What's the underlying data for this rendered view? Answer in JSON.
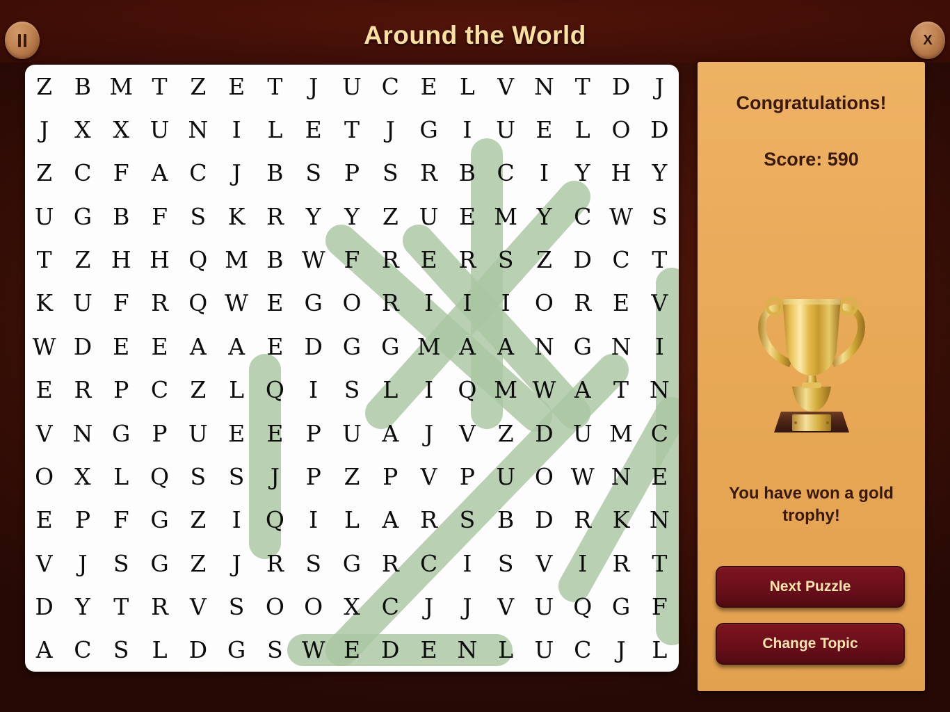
{
  "header": {
    "title": "Around the World",
    "pause_button": {
      "name": "pause-icon",
      "label": "II"
    },
    "close_button": {
      "name": "close-icon",
      "label": "X"
    }
  },
  "panel": {
    "congratulations": "Congratulations!",
    "score_label": "Score: 590",
    "score_value": 590,
    "trophy_icon": "gold-trophy-icon",
    "prize_text": "You have won a gold trophy!",
    "next_puzzle_label": "Next Puzzle",
    "change_topic_label": "Change Topic"
  },
  "colors": {
    "background": "#3a0f07",
    "title": "#fbe0a0",
    "panel_bg": "#e8a957",
    "panel_text": "#3a1a06",
    "button_bg": "#6a0f1a",
    "button_text": "#fbe3ae",
    "grid_bg": "#fdfdfd",
    "letter": "#0c0c0c",
    "highlight": "#a9c6a2"
  },
  "grid": {
    "rows": 14,
    "cols": 17,
    "letters": [
      [
        "Z",
        "B",
        "M",
        "T",
        "Z",
        "E",
        "T",
        "J",
        "U",
        "C",
        "E",
        "L",
        "V",
        "N",
        "T",
        "D",
        "J"
      ],
      [
        "J",
        "X",
        "X",
        "U",
        "N",
        "I",
        "L",
        "E",
        "T",
        "J",
        "G",
        "I",
        "U",
        "E",
        "L",
        "O",
        "D"
      ],
      [
        "Z",
        "C",
        "F",
        "A",
        "C",
        "J",
        "B",
        "S",
        "P",
        "S",
        "R",
        "B",
        "C",
        "I",
        "Y",
        "H",
        "Y"
      ],
      [
        "U",
        "G",
        "B",
        "F",
        "S",
        "K",
        "R",
        "Y",
        "Y",
        "Z",
        "U",
        "E",
        "M",
        "Y",
        "C",
        "W",
        "S"
      ],
      [
        "T",
        "Z",
        "H",
        "H",
        "Q",
        "M",
        "B",
        "W",
        "F",
        "R",
        "E",
        "R",
        "S",
        "Z",
        "D",
        "C",
        "T"
      ],
      [
        "K",
        "U",
        "F",
        "R",
        "Q",
        "W",
        "E",
        "G",
        "O",
        "R",
        "I",
        "I",
        "I",
        "O",
        "R",
        "E",
        "V"
      ],
      [
        "W",
        "D",
        "E",
        "E",
        "A",
        "A",
        "E",
        "D",
        "G",
        "G",
        "M",
        "A",
        "A",
        "N",
        "G",
        "N",
        "I"
      ],
      [
        "E",
        "R",
        "P",
        "C",
        "Z",
        "L",
        "Q",
        "I",
        "S",
        "L",
        "I",
        "Q",
        "M",
        "W",
        "A",
        "T",
        "N"
      ],
      [
        "V",
        "N",
        "G",
        "P",
        "U",
        "E",
        "E",
        "P",
        "U",
        "A",
        "J",
        "V",
        "Z",
        "D",
        "U",
        "M",
        "C"
      ],
      [
        "O",
        "X",
        "L",
        "Q",
        "S",
        "S",
        "J",
        "P",
        "Z",
        "P",
        "V",
        "P",
        "U",
        "O",
        "W",
        "N",
        "E"
      ],
      [
        "E",
        "P",
        "F",
        "G",
        "Z",
        "I",
        "Q",
        "I",
        "L",
        "A",
        "R",
        "S",
        "B",
        "D",
        "R",
        "K",
        "N"
      ],
      [
        "V",
        "J",
        "S",
        "G",
        "Z",
        "J",
        "R",
        "S",
        "G",
        "R",
        "C",
        "I",
        "S",
        "V",
        "I",
        "R",
        "T"
      ],
      [
        "D",
        "Y",
        "T",
        "R",
        "V",
        "S",
        "O",
        "O",
        "X",
        "C",
        "J",
        "J",
        "V",
        "U",
        "Q",
        "G",
        "F"
      ],
      [
        "A",
        "C",
        "S",
        "L",
        "D",
        "G",
        "S",
        "W",
        "E",
        "D",
        "E",
        "N",
        "L",
        "U",
        "C",
        "J",
        "L"
      ]
    ],
    "found_words": [
      {
        "word": "LIBERIA",
        "orientation": "vertical",
        "start": [
          1,
          12
        ],
        "end": [
          7,
          12
        ]
      },
      {
        "word": "WALES",
        "orientation": "vertical",
        "start": [
          6,
          6
        ],
        "end": [
          10,
          6
        ]
      },
      {
        "word": "ST VINCENT",
        "orientation": "vertical",
        "start": [
          4,
          17
        ],
        "end": [
          12,
          17
        ]
      },
      {
        "word": "SWEDEN",
        "orientation": "horizontal",
        "start": [
          14,
          7
        ],
        "end": [
          14,
          12
        ]
      },
      {
        "word": "SINGAPORE",
        "orientation": "diagonal-up",
        "start": [
          3,
          8
        ],
        "end": [
          7,
          13
        ]
      },
      {
        "word": "SURINAME",
        "orientation": "diagonal-down",
        "start": [
          3,
          10
        ],
        "end": [
          7,
          14
        ]
      },
      {
        "word": "ECUADOR",
        "orientation": "diagonal-up",
        "start": [
          2,
          14
        ],
        "end": [
          7,
          9
        ]
      },
      {
        "word": "ARGENTINA",
        "orientation": "diagonal-up",
        "start": [
          14,
          8
        ],
        "end": [
          7,
          15
        ]
      },
      {
        "word": "AUSTRIA",
        "orientation": "diagonal-up",
        "start": [
          11,
          16
        ],
        "end": [
          7,
          12
        ]
      }
    ]
  }
}
